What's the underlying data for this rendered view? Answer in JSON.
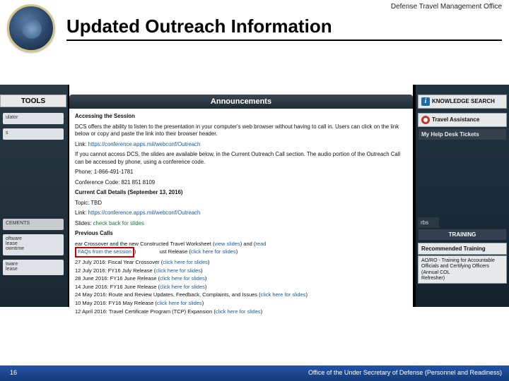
{
  "header": {
    "org": "Defense Travel Management Office",
    "title": "Updated Outreach Information"
  },
  "left": {
    "tools": "TOOLS",
    "items": [
      "ulator",
      "s",
      "CEMENTS",
      "oftware\nlease\nowntime",
      "tware\nlease"
    ]
  },
  "center": {
    "announcements": "Announcements",
    "accessTitle": "Accessing the Session",
    "accessBody": "DCS offers the ability to listen to the presentation in your computer's web browser without having to call in. Users can click on the link below or copy and paste the link into their browser header.",
    "linkLabel": "Link:",
    "linkUrl": "https://conference.apps.mil/webconf/Outreach",
    "fallback": "If you cannot access DCS, the slides are available below, in the Current Outreach Call section. The audio portion of the Outreach Call can be accessed by phone, using a conference code.",
    "phone": "Phone: 1-866-491-1781",
    "confcode": "Conference Code: 821 851 8109",
    "currentTitle": "Current Call Details (September 13, 2016)",
    "topic": "Topic: TBD",
    "curLinkLabel": "Link:",
    "slidesLabel": "Slides:",
    "slidesLink": "check back for slides",
    "prevTitle": "Previous Calls",
    "row1a": "ear Crossover and the new Constructed Travel Worksheet (",
    "viewSlides": "view slides",
    "row1b": ") and (",
    "row1c": "read",
    "faqs": "FAQs from the session",
    "row1d": ")",
    "suffixRelease": "ust Release (",
    "clickhere": "click here for slides",
    "p1": "27 July 2016: Fiscal Year Crossover (",
    "p2": "12 July 2016: FY16 July Release (",
    "p3": "28 June 2016: FY16 June Release (",
    "p4": "14 June 2016: FY16 June Release (",
    "p5": "24 May 2016: Route and Review Updates, Feedback, Complaints, and Issues (",
    "p6": "10 May 2016: FY16 May Release (",
    "p7": "12 April 2016: Travel Certificate Program (TCP) Expansion (",
    "close": ")"
  },
  "right": {
    "knowledge": "KNOWLEDGE SEARCH",
    "travel": "Travel Assistance",
    "tickets": "My Help Desk Tickets",
    "rbs": "rbs",
    "training": "TRAINING",
    "rec": "Recommended Training",
    "aoro1": "AO/RO - Training for Accountable Officials and Certifying Officers (Annual COL",
    "aoro2": "Refresher)"
  },
  "footer": {
    "page": "16",
    "text": "Office of the Under Secretary of Defense (Personnel and Readiness)"
  }
}
